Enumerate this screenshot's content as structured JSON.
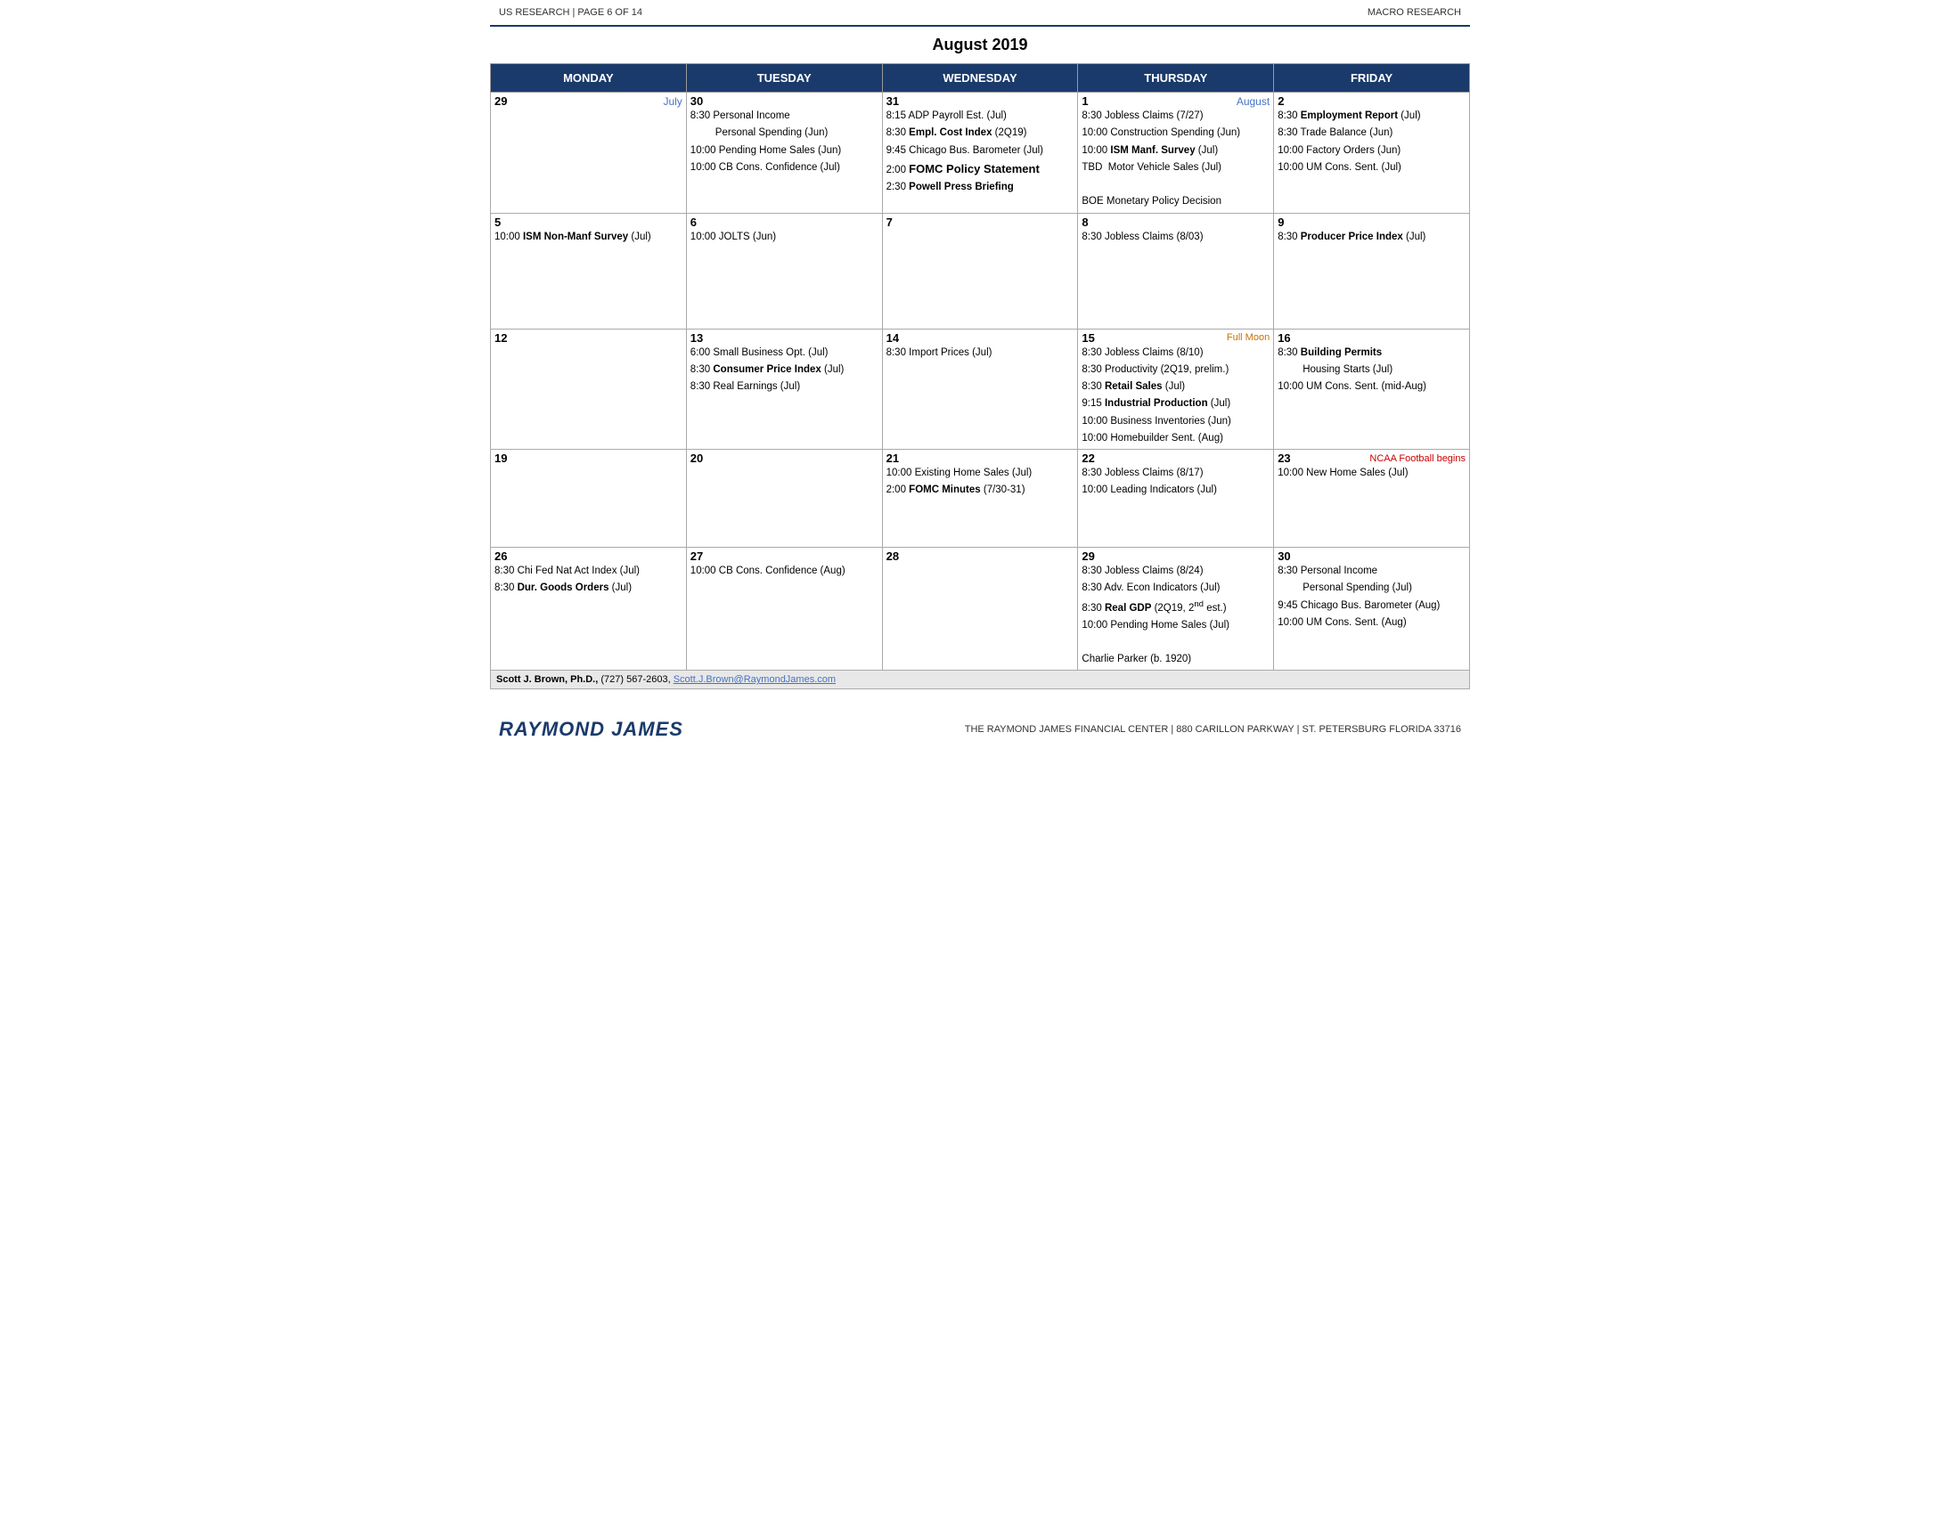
{
  "header": {
    "left": "US RESEARCH | PAGE 6 OF 14",
    "right": "MACRO RESEARCH"
  },
  "title": "August 2019",
  "columns": [
    "MONDAY",
    "TUESDAY",
    "WEDNESDAY",
    "THURSDAY",
    "FRIDAY"
  ],
  "weeks": [
    {
      "dates": [
        {
          "num": "29",
          "tag": "July",
          "tag_color": "blue",
          "events": []
        },
        {
          "num": "30",
          "tag": "",
          "events": [
            {
              "text": "8:30 Personal Income"
            },
            {
              "text": "Personal Spending (Jun)",
              "indent": true
            },
            {
              "text": "10:00 Pending Home Sales (Jun)"
            },
            {
              "text": "10:00 CB Cons. Confidence (Jul)"
            }
          ]
        },
        {
          "num": "31",
          "tag": "",
          "events": [
            {
              "text": "8:15 ADP Payroll Est. (Jul)"
            },
            {
              "text": "8:30 Empl. Cost Index (2Q19)",
              "bold_part": "Empl. Cost Index"
            },
            {
              "text": "9:45 Chicago Bus. Barometer (Jul)"
            },
            {
              "text": "2:00 FOMC Policy Statement",
              "large_bold": true
            },
            {
              "text": "2:30 Powell Press Briefing",
              "semi_bold": true
            }
          ]
        },
        {
          "num": "1",
          "tag": "August",
          "tag_color": "blue",
          "events": [
            {
              "text": "8:30 Jobless Claims (7/27)"
            },
            {
              "text": "10:00 Construction Spending (Jun)"
            },
            {
              "text": "10:00 ISM Manf. Survey (Jul)",
              "bold_part": "ISM Manf. Survey"
            },
            {
              "text": "TBD  Motor Vehicle Sales (Jul)"
            },
            {
              "text": ""
            },
            {
              "text": "BOE Monetary Policy Decision"
            }
          ]
        },
        {
          "num": "2",
          "tag": "",
          "events": [
            {
              "text": "8:30 Employment Report (Jul)",
              "bold_part": "Employment Report"
            },
            {
              "text": "8:30 Trade Balance (Jun)"
            },
            {
              "text": "10:00 Factory Orders (Jun)"
            },
            {
              "text": "10:00 UM Cons. Sent. (Jul)"
            }
          ]
        }
      ]
    },
    {
      "dates": [
        {
          "num": "5",
          "tag": "",
          "events": [
            {
              "text": "10:00 ISM Non-Manf Survey (Jul)",
              "bold_part": "ISM Non-Manf Survey"
            }
          ]
        },
        {
          "num": "6",
          "tag": "",
          "events": [
            {
              "text": "10:00 JOLTS (Jun)"
            }
          ]
        },
        {
          "num": "7",
          "tag": "",
          "events": []
        },
        {
          "num": "8",
          "tag": "",
          "events": [
            {
              "text": "8:30 Jobless Claims (8/03)"
            }
          ]
        },
        {
          "num": "9",
          "tag": "",
          "events": [
            {
              "text": "8:30 Producer Price Index (Jul)",
              "bold_part": "Producer Price Index"
            }
          ]
        }
      ]
    },
    {
      "dates": [
        {
          "num": "12",
          "tag": "",
          "events": []
        },
        {
          "num": "13",
          "tag": "",
          "events": [
            {
              "text": "6:00 Small Business Opt. (Jul)"
            },
            {
              "text": "8:30 Consumer Price Index (Jul)",
              "bold_part": "Consumer Price Index"
            },
            {
              "text": "8:30 Real Earnings (Jul)"
            }
          ]
        },
        {
          "num": "14",
          "tag": "",
          "events": [
            {
              "text": "8:30 Import Prices (Jul)"
            }
          ]
        },
        {
          "num": "15",
          "tag": "Full Moon",
          "tag_color": "orange",
          "events": [
            {
              "text": "8:30 Jobless Claims (8/10)"
            },
            {
              "text": "8:30 Productivity (2Q19, prelim.)"
            },
            {
              "text": "8:30 Retail Sales (Jul)",
              "bold_part": "Retail Sales"
            },
            {
              "text": "9:15 Industrial Production (Jul)",
              "bold_part": "Industrial Production"
            },
            {
              "text": "10:00 Business Inventories (Jun)"
            },
            {
              "text": "10:00 Homebuilder Sent. (Aug)"
            }
          ]
        },
        {
          "num": "16",
          "tag": "",
          "events": [
            {
              "text": "8:30 Building Permits",
              "bold_part": "Building Permits"
            },
            {
              "text": "Housing Starts (Jul)",
              "indent": true
            },
            {
              "text": "10:00 UM Cons. Sent. (mid-Aug)"
            }
          ]
        }
      ]
    },
    {
      "dates": [
        {
          "num": "19",
          "tag": "",
          "events": []
        },
        {
          "num": "20",
          "tag": "",
          "events": []
        },
        {
          "num": "21",
          "tag": "",
          "events": [
            {
              "text": "10:00 Existing Home Sales (Jul)"
            },
            {
              "text": "2:00 FOMC Minutes (7/30-31)",
              "bold_part": "FOMC Minutes"
            }
          ]
        },
        {
          "num": "22",
          "tag": "",
          "events": [
            {
              "text": "8:30 Jobless Claims (8/17)"
            },
            {
              "text": "10:00 Leading Indicators (Jul)"
            }
          ]
        },
        {
          "num": "23",
          "tag": "NCAA Football begins",
          "tag_color": "red",
          "events": [
            {
              "text": "10:00 New Home Sales (Jul)"
            }
          ]
        }
      ]
    },
    {
      "dates": [
        {
          "num": "26",
          "tag": "",
          "events": [
            {
              "text": "8:30 Chi Fed Nat Act Index (Jul)"
            },
            {
              "text": "8:30 Dur. Goods Orders (Jul)",
              "bold_part": "Dur. Goods Orders"
            }
          ]
        },
        {
          "num": "27",
          "tag": "",
          "events": [
            {
              "text": "10:00 CB Cons. Confidence (Aug)"
            }
          ]
        },
        {
          "num": "28",
          "tag": "",
          "events": []
        },
        {
          "num": "29",
          "tag": "",
          "events": [
            {
              "text": "8:30 Jobless Claims (8/24)"
            },
            {
              "text": "8:30 Adv. Econ Indicators (Jul)"
            },
            {
              "text": "8:30 Real GDP (2Q19, 2nd est.)",
              "bold_part": "Real GDP",
              "superscript": "nd"
            },
            {
              "text": "10:00 Pending Home Sales (Jul)"
            },
            {
              "text": ""
            },
            {
              "text": "Charlie Parker (b. 1920)"
            }
          ]
        },
        {
          "num": "30",
          "tag": "",
          "events": [
            {
              "text": "8:30 Personal Income"
            },
            {
              "text": "Personal Spending (Jul)",
              "indent": true
            },
            {
              "text": "9:45 Chicago Bus. Barometer (Aug)"
            },
            {
              "text": "10:00 UM Cons. Sent. (Aug)"
            }
          ]
        }
      ]
    }
  ],
  "footer": {
    "author": "Scott J. Brown, Ph.D.,",
    "phone": " (727) 567-2603, ",
    "email": "Scott.J.Brown@RaymondJames.com"
  },
  "page_footer": {
    "logo": "RAYMOND JAMES",
    "address": "THE RAYMOND JAMES FINANCIAL CENTER | 880 CARILLON PARKWAY | ST. PETERSBURG FLORIDA 33716"
  }
}
